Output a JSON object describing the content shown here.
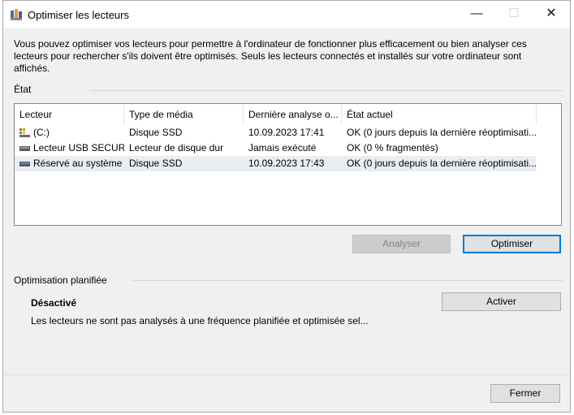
{
  "window": {
    "title": "Optimiser les lecteurs",
    "description": "Vous pouvez optimiser vos lecteurs pour permettre à l'ordinateur de fonctionner plus efficacement ou bien analyser ces lecteurs pour rechercher s'ils doivent être optimisés. Seuls les lecteurs connectés et installés sur votre ordinateur sont affichés."
  },
  "status": {
    "label": "État",
    "columns": [
      "Lecteur",
      "Type de média",
      "Dernière analyse o...",
      "État actuel"
    ],
    "rows": [
      {
        "drive": "(C:)",
        "media": "Disque SSD",
        "last": "10.09.2023 17:41",
        "state": "OK (0 jours depuis la dernière réoptimisati...",
        "icon": "system-drive-icon"
      },
      {
        "drive": "Lecteur USB SECUR...",
        "media": "Lecteur de disque dur",
        "last": "Jamais exécuté",
        "state": "OK (0 % fragmentés)",
        "icon": "usb-drive-icon"
      },
      {
        "drive": "Réservé au système",
        "media": "Disque SSD",
        "last": "10.09.2023 17:43",
        "state": "OK (0 jours depuis la dernière réoptimisati...",
        "icon": "drive-icon"
      }
    ]
  },
  "actions": {
    "analyze": "Analyser",
    "optimize": "Optimiser"
  },
  "schedule": {
    "label": "Optimisation planifiée",
    "state": "Désactivé",
    "text": "Les lecteurs ne sont pas analysés à une fréquence planifiée et optimisée sel...",
    "activate": "Activer"
  },
  "footer": {
    "close": "Fermer"
  }
}
